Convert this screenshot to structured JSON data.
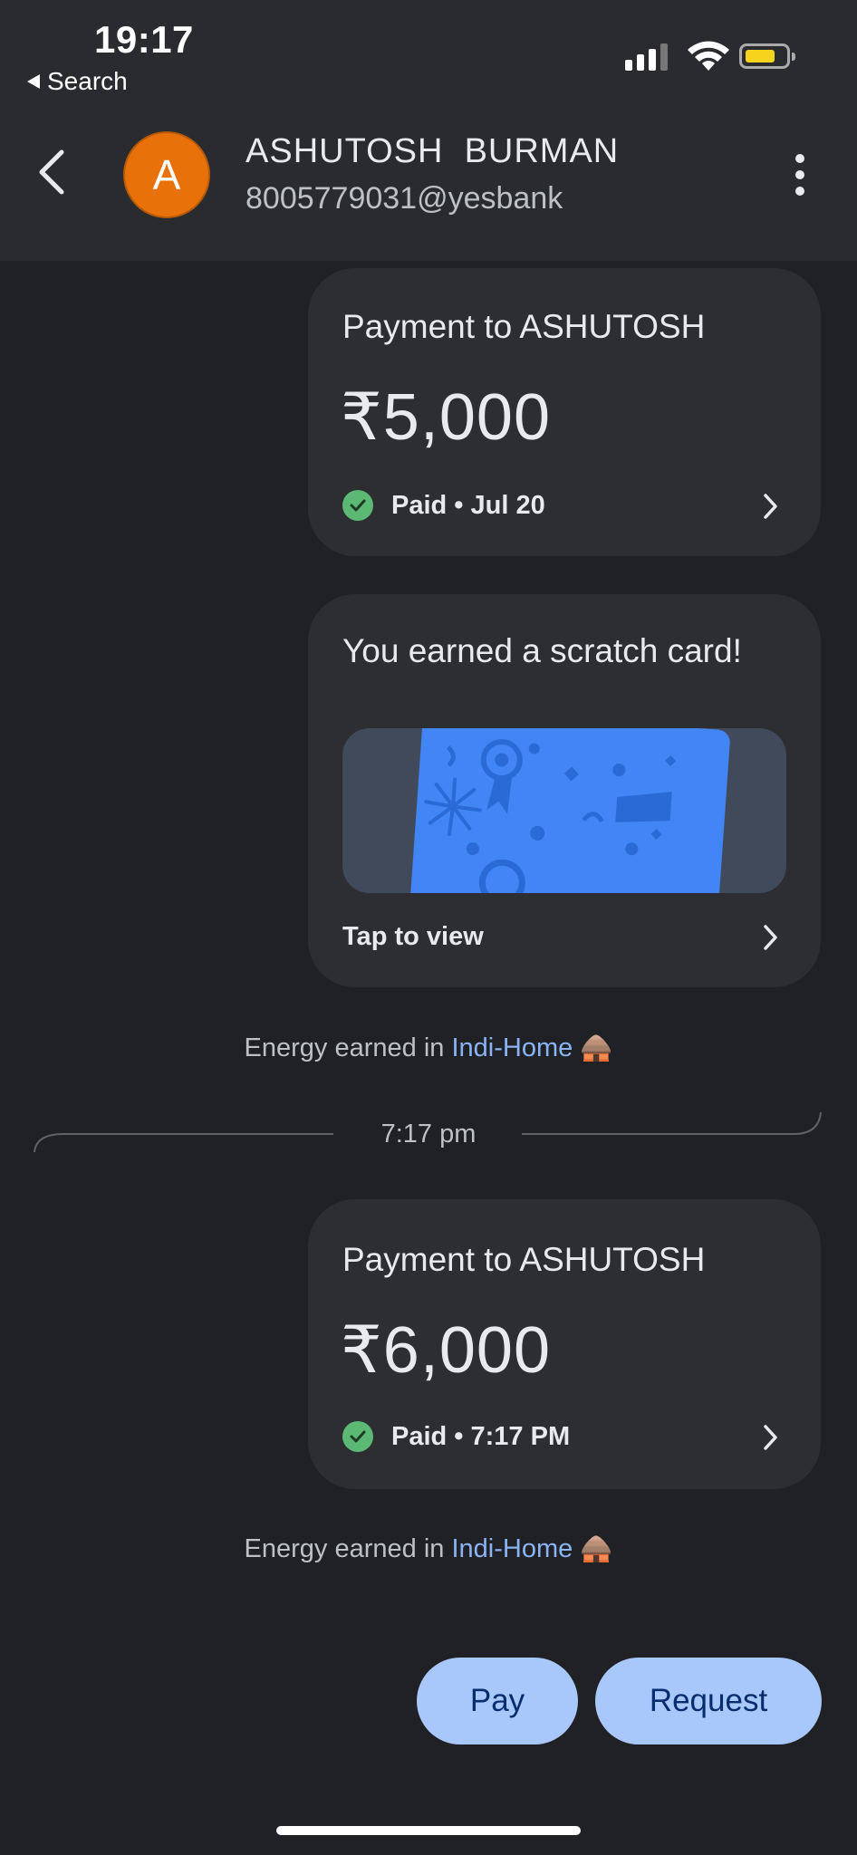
{
  "status_bar": {
    "time": "19:17",
    "back_app": "Search",
    "battery_color": "#f6d31c"
  },
  "header": {
    "avatar_letter": "A",
    "avatar_color": "#e8710a",
    "name": "ASHUTOSH  BURMAN",
    "upi_id": "8005779031@yesbank"
  },
  "messages": [
    {
      "type": "payment",
      "title": "Payment to ASHUTOSH",
      "amount": "₹5,000",
      "status": "Paid • Jul 20"
    },
    {
      "type": "scratch_card",
      "title": "You earned a scratch card!",
      "action": "Tap to view"
    },
    {
      "type": "energy",
      "prefix": "Energy earned in ",
      "link": "Indi-Home",
      "emoji": "🛖"
    },
    {
      "type": "time_divider",
      "label": "7:17 pm"
    },
    {
      "type": "payment",
      "title": "Payment to ASHUTOSH",
      "amount": "₹6,000",
      "status": "Paid • 7:17 PM"
    },
    {
      "type": "energy",
      "prefix": "Energy earned in ",
      "link": "Indi-Home",
      "emoji": "🛖"
    }
  ],
  "actions": {
    "pay_label": "Pay",
    "request_label": "Request"
  }
}
